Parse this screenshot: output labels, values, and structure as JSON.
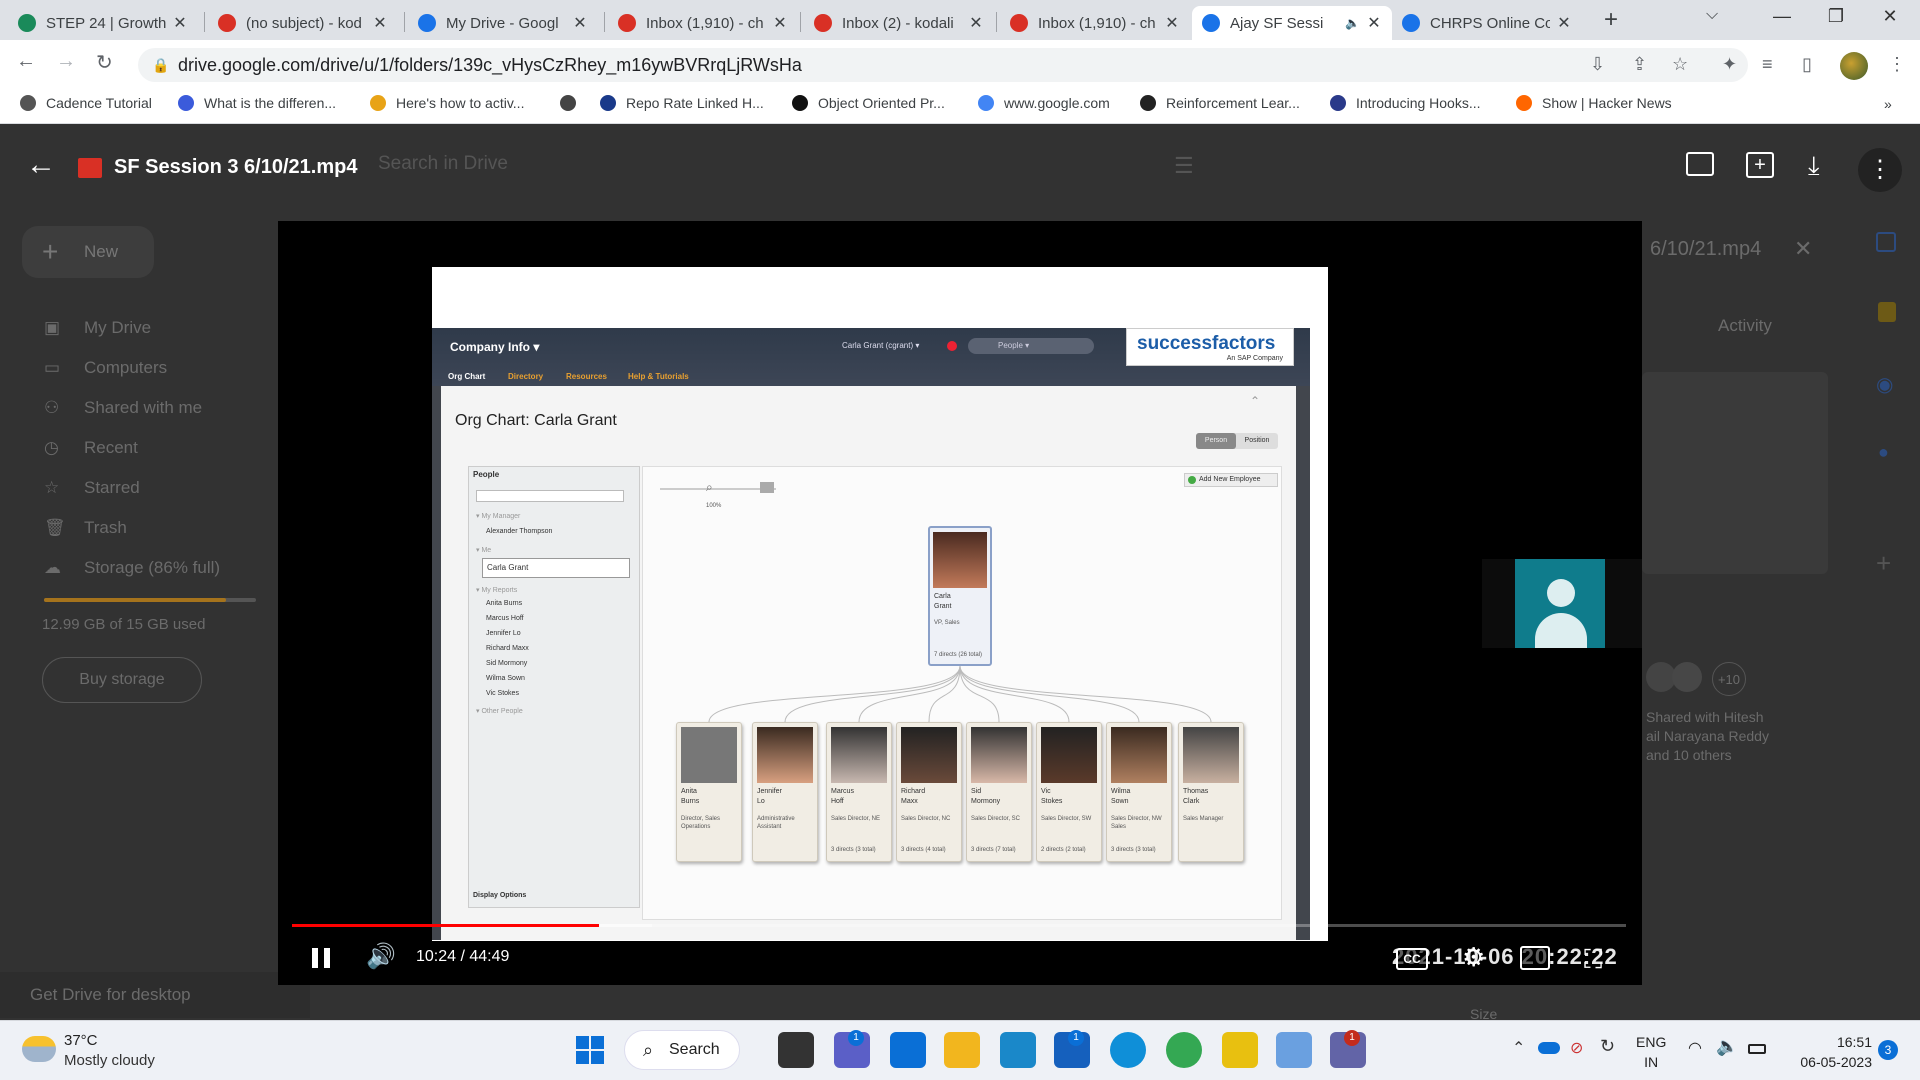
{
  "tabs": [
    {
      "title": "STEP 24 | Growth",
      "icon": "step-favicon-icon",
      "color": "#1a8a5a"
    },
    {
      "title": "(no subject) - kod",
      "icon": "gmail-icon",
      "color": "#d93025"
    },
    {
      "title": "My Drive - Googl",
      "icon": "google-drive-icon",
      "color": "#1a73e8"
    },
    {
      "title": "Inbox (1,910) - ch",
      "icon": "gmail-icon",
      "color": "#d93025"
    },
    {
      "title": "Inbox (2) - kodali",
      "icon": "gmail-icon",
      "color": "#d93025"
    },
    {
      "title": "Inbox (1,910) - ch",
      "icon": "gmail-icon",
      "color": "#d93025"
    },
    {
      "title": "Ajay SF Sessi",
      "icon": "google-drive-icon",
      "color": "#1a73e8",
      "active": true
    },
    {
      "title": "CHRPS Online Co",
      "icon": "zoho-z-icon",
      "color": "#1a73e8"
    }
  ],
  "address": "drive.google.com/drive/u/1/folders/139c_vHysCzRhey_m16ywBVRrqLjRWsHa",
  "bookmarks": [
    "Cadence Tutorial",
    "What is the differen...",
    "Here's how to activ...",
    "",
    "Repo Rate Linked H...",
    "Object Oriented Pr...",
    "www.google.com",
    "Reinforcement Lear...",
    "Introducing Hooks...",
    "Show | Hacker News"
  ],
  "drive": {
    "file_title": "SF Session 3 6/10/21.mp4",
    "search_placeholder": "Search in Drive",
    "new_label": "New",
    "nav": [
      "My Drive",
      "Computers",
      "Shared with me",
      "Recent",
      "Starred",
      "Trash",
      "Storage (86% full)"
    ],
    "storage_used": "12.99 GB of 15 GB used",
    "buy_storage": "Buy storage",
    "get_drive": "Get Drive for desktop",
    "side_title": "6/10/21.mp4",
    "activity": "Activity",
    "shared_with": "Shared with Hitesh",
    "shared_with2": "ail Narayana Reddy",
    "shared_with3": "and 10 others",
    "plus_count": "+10",
    "size_label": "Size"
  },
  "video": {
    "time": "10:24 / 44:49",
    "progress": 0.23,
    "buffered": 0.27,
    "overlay_date": "2021-10-06 20:22:22",
    "cc": "CC"
  },
  "sf": {
    "menu_title": "Company Info",
    "nav": [
      "Org Chart",
      "Directory",
      "Resources",
      "Help & Tutorials"
    ],
    "user": "Carla Grant (cgrant)",
    "search_scope": "People",
    "logo": "successfactors",
    "logo_sub": "An SAP Company",
    "page_title": "Org Chart: Carla Grant",
    "toggle": [
      "Person",
      "Position"
    ],
    "add_employee": "Add New Employee",
    "zoom": "100%",
    "people_header": "People",
    "my_manager": "My Manager",
    "manager": "Alexander Thompson",
    "me_label": "Me",
    "me": "Carla Grant",
    "my_reports": "My Reports",
    "reports": [
      "Anita Burns",
      "Marcus Hoff",
      "Jennifer Lo",
      "Richard Maxx",
      "Sid Mormony",
      "Wilma Sown",
      "Vic Stokes"
    ],
    "other_people": "Other People",
    "display_options": "Display Options",
    "root": {
      "name1": "Carla",
      "name2": "Grant",
      "title": "VP, Sales",
      "directs": "7 directs (26 total)"
    },
    "cards": [
      {
        "n1": "Anita",
        "n2": "Burns",
        "t": "Director, Sales Operations",
        "d": ""
      },
      {
        "n1": "Jennifer",
        "n2": "Lo",
        "t": "Administrative Assistant",
        "d": ""
      },
      {
        "n1": "Marcus",
        "n2": "Hoff",
        "t": "Sales Director, NE",
        "d": "3 directs (3 total)"
      },
      {
        "n1": "Richard",
        "n2": "Maxx",
        "t": "Sales Director, NC",
        "d": "3 directs (4 total)"
      },
      {
        "n1": "Sid",
        "n2": "Mormony",
        "t": "Sales Director, SC",
        "d": "3 directs (7 total)"
      },
      {
        "n1": "Vic",
        "n2": "Stokes",
        "t": "Sales Director, SW",
        "d": "2 directs (2 total)"
      },
      {
        "n1": "Wilma",
        "n2": "Sown",
        "t": "Sales Director, NW Sales",
        "d": "3 directs (3 total)"
      },
      {
        "n1": "Thomas",
        "n2": "Clark",
        "t": "Sales Manager",
        "d": ""
      }
    ]
  },
  "taskbar": {
    "weather_temp": "37°C",
    "weather_desc": "Mostly cloudy",
    "search": "Search",
    "lang1": "ENG",
    "lang2": "IN",
    "time": "16:51",
    "date": "06-05-2023",
    "notif_count": "3",
    "badge1": "1",
    "badge2": "1",
    "badge3": "1"
  }
}
